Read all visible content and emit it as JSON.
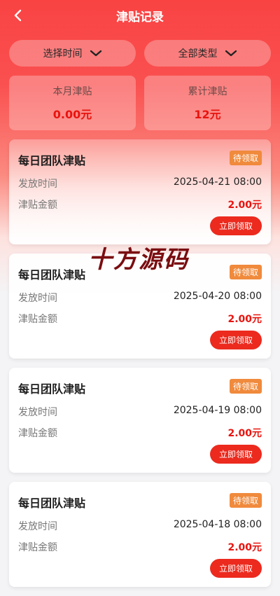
{
  "header": {
    "title": "津贴记录"
  },
  "filters": {
    "time_label": "选择时间",
    "type_label": "全部类型"
  },
  "stats": {
    "month_label": "本月津贴",
    "month_value": "0.00元",
    "total_label": "累计津贴",
    "total_value": "12元"
  },
  "records": [
    {
      "title": "每日团队津贴",
      "status": "待领取",
      "time_label": "发放时间",
      "time_value": "2025-04-21 08:00",
      "amount_label": "津贴金额",
      "amount_value": "2.00元",
      "action": "立即领取"
    },
    {
      "title": "每日团队津贴",
      "status": "待领取",
      "time_label": "发放时间",
      "time_value": "2025-04-20 08:00",
      "amount_label": "津贴金额",
      "amount_value": "2.00元",
      "action": "立即领取"
    },
    {
      "title": "每日团队津贴",
      "status": "待领取",
      "time_label": "发放时间",
      "time_value": "2025-04-19 08:00",
      "amount_label": "津贴金额",
      "amount_value": "2.00元",
      "action": "立即领取"
    },
    {
      "title": "每日团队津贴",
      "status": "待领取",
      "time_label": "发放时间",
      "time_value": "2025-04-18 08:00",
      "amount_label": "津贴金额",
      "amount_value": "2.00元",
      "action": "立即领取"
    }
  ],
  "watermark": "十方源码",
  "icons": {
    "back": "chevron-left-icon",
    "dropdown": "chevron-down-icon"
  },
  "colors": {
    "brand_red": "#f94343",
    "amount_red": "#e8140f",
    "badge_orange": "#f08a3c",
    "button_red": "#ec2a1e"
  }
}
